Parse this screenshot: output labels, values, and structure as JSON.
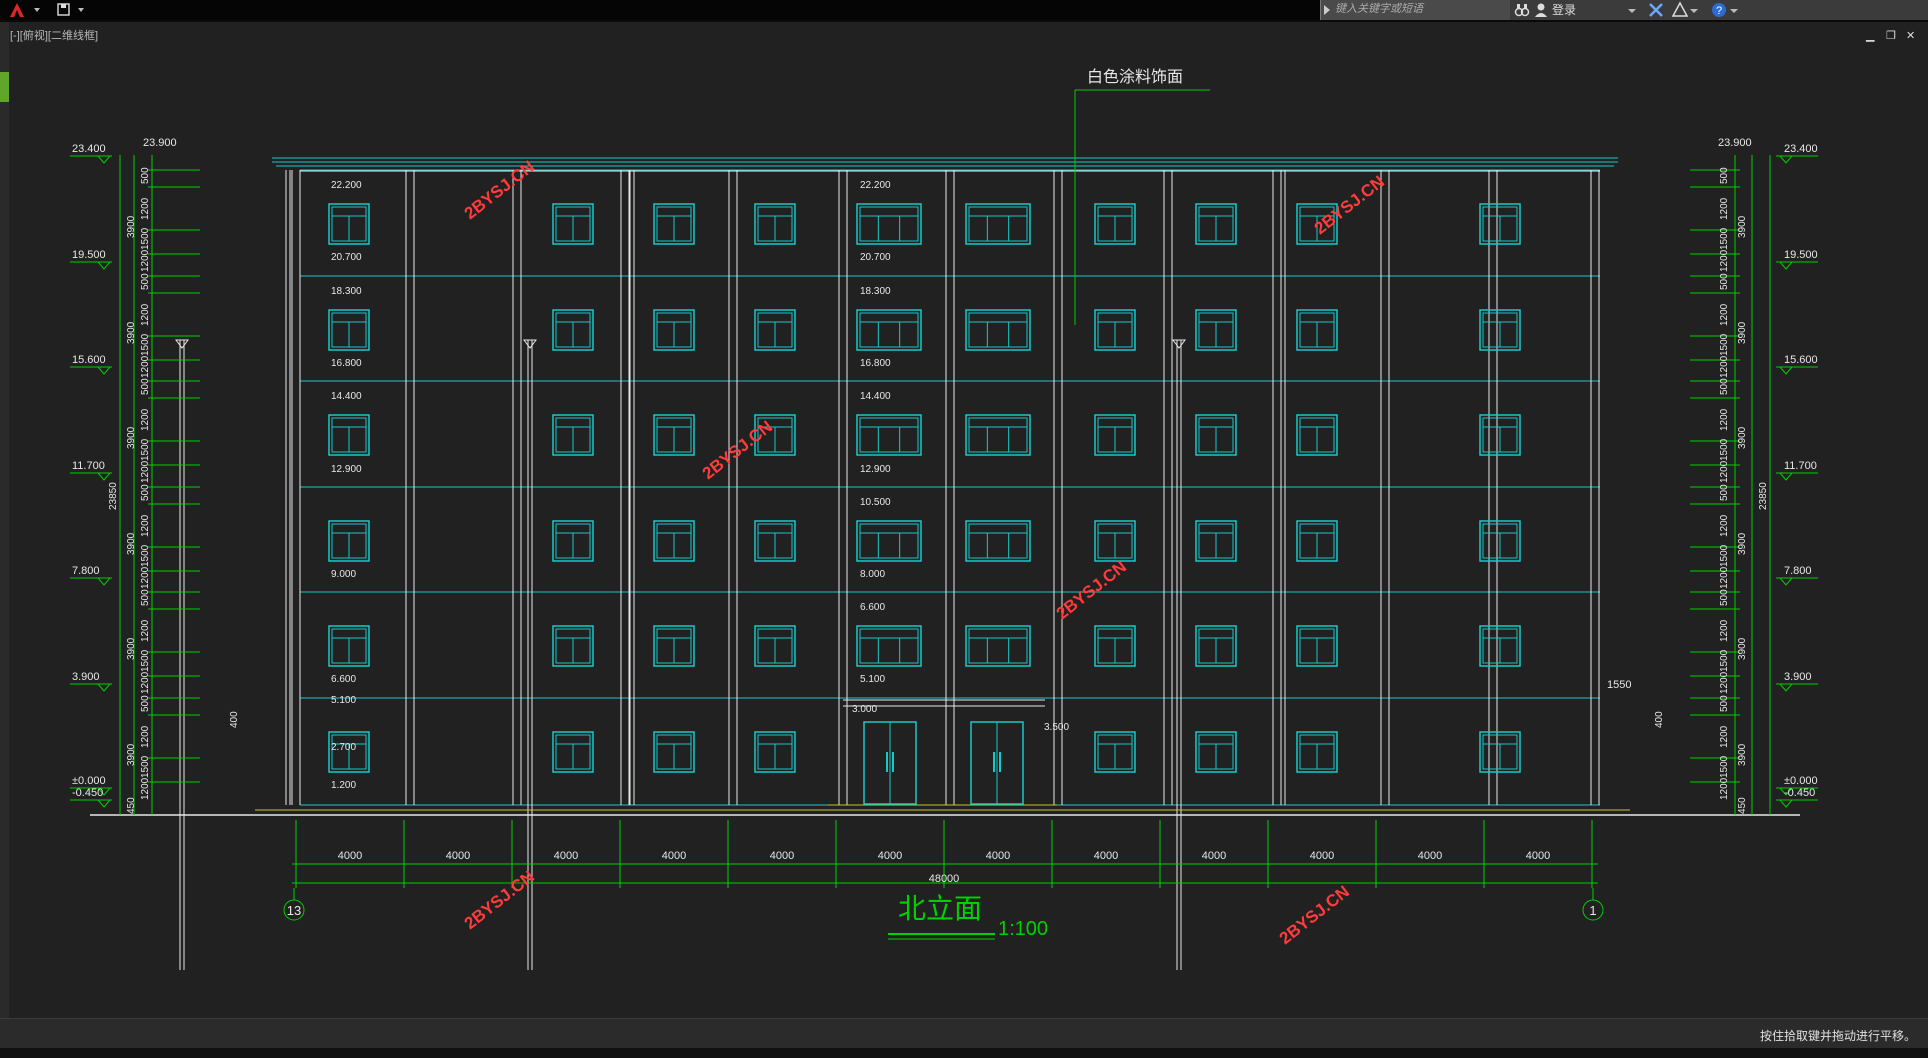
{
  "app": {
    "search_placeholder": "键入关键字或短语",
    "login_label": "登录",
    "viewport_label": "[-][俯视][二维线框]",
    "status_message": "按住拾取键并拖动进行平移。"
  },
  "drawing": {
    "title": "北立面",
    "scale": "1:100",
    "material_note": "白色涂料饰面",
    "watermark": "2BYSJ.CN",
    "axis_left": "13",
    "axis_right": "1",
    "bay_width": "4000",
    "total_width": "48000",
    "top_left_elev": "23.900",
    "top_right_elev": "23.900",
    "left_elevations": [
      "23.400",
      "19.500",
      "15.600",
      "11.700",
      "7.800",
      "3.900",
      "±0.000",
      "-0.450"
    ],
    "right_elevations": [
      "23.400",
      "19.500",
      "15.600",
      "11.700",
      "7.800",
      "3.900",
      "±0.000",
      "-0.450"
    ],
    "total_height": "23850",
    "floor_dim": "3900",
    "dims_small": [
      "500",
      "1200",
      "1500",
      "1200",
      "450"
    ],
    "canopy_elev": "3.000",
    "canopy_right": "3.500",
    "side_dim": "1550",
    "side_dim2": "400",
    "window_elevs_a": [
      "22.200",
      "20.700",
      "18.300",
      "16.800",
      "14.400",
      "12.900",
      "9.000",
      "6.600",
      "5.100",
      "2.700",
      "1.200"
    ],
    "window_elevs_b": [
      "22.200",
      "20.700",
      "18.300",
      "16.800",
      "14.400",
      "12.900",
      "10.500",
      "8.000",
      "6.600",
      "5.100"
    ]
  },
  "colors": {
    "green": "#00d000",
    "cyan": "#19c8c8",
    "white": "#e8e8e8",
    "red": "#ff3b3b",
    "yellow": "#c8c820"
  }
}
